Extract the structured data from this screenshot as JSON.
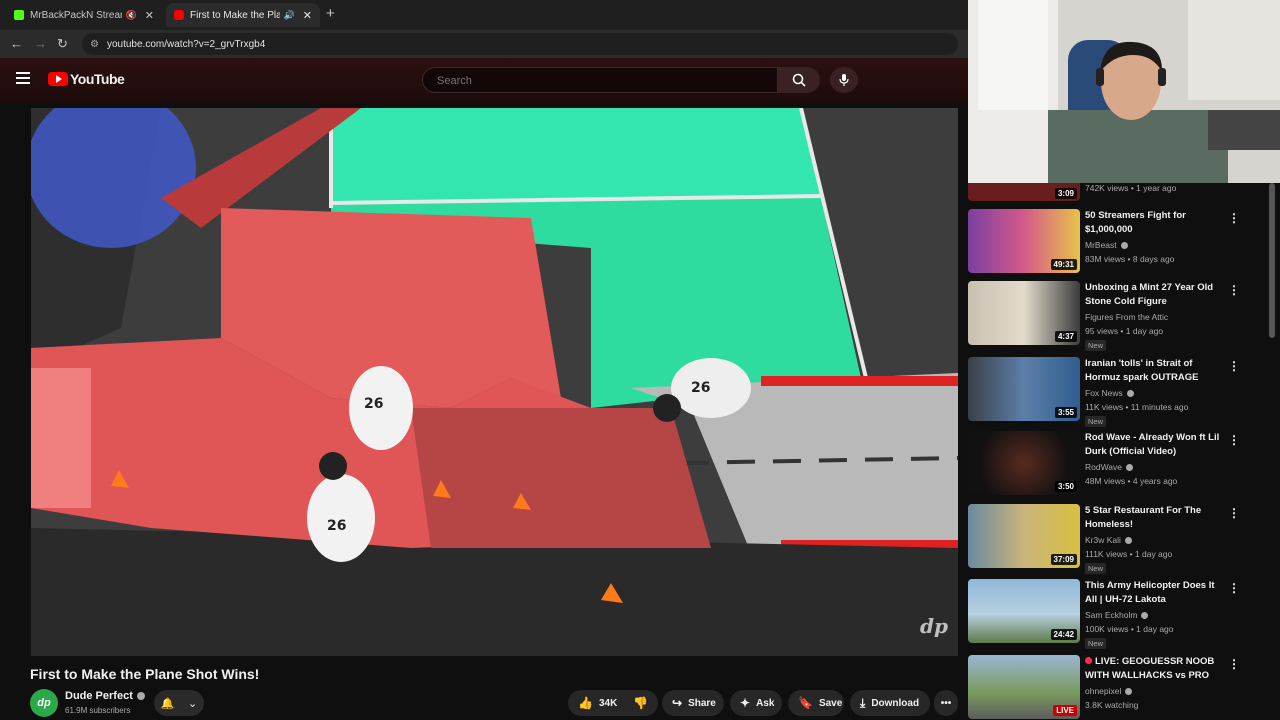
{
  "browser": {
    "tabs": [
      {
        "title": "MrBackPackN Stream - Wa",
        "icon_color": "#53fc18"
      },
      {
        "title": "First to Make the Plane Sho",
        "icon_color": "#ff0000"
      }
    ],
    "new_tab": "+",
    "url": "youtube.com/watch?v=2_grvTrxgb4"
  },
  "youtube": {
    "logo_text": "YouTube",
    "search_placeholder": "Search"
  },
  "video": {
    "title": "First to Make the Plane Shot Wins!",
    "watermark": "dp",
    "channel": {
      "name": "Dude Perfect",
      "subscribers": "61.9M subscribers",
      "avatar_text": "dp"
    },
    "actions": {
      "likes": "34K",
      "share": "Share",
      "ask": "Ask",
      "save": "Save",
      "download": "Download"
    }
  },
  "recommendations": {
    "partial_top": {
      "duration": "3:09",
      "meta": "742K views • 1 year ago"
    },
    "items": [
      {
        "title": "50 Streamers Fight for $1,000,000",
        "channel": "MrBeast",
        "verified": true,
        "meta": "83M views • 8 days ago",
        "duration": "49:31",
        "badge": ""
      },
      {
        "title": "Unboxing a Mint 27 Year Old Stone Cold Figure",
        "channel": "Figures From the Attic",
        "verified": false,
        "meta": "95 views • 1 day ago",
        "duration": "4:37",
        "badge": "New"
      },
      {
        "title": "Iranian 'tolls' in Strait of Hormuz spark OUTRAGE",
        "channel": "Fox News",
        "verified": true,
        "meta": "11K views • 11 minutes ago",
        "duration": "3:55",
        "badge": "New"
      },
      {
        "title": "Rod Wave - Already Won ft Lil Durk (Official Video)",
        "channel": "RodWave",
        "verified": true,
        "meta": "48M views • 4 years ago",
        "duration": "3:50",
        "badge": ""
      },
      {
        "title": "5 Star Restaurant For The Homeless!",
        "channel": "Kr3w Kali",
        "verified": true,
        "meta": "111K views • 1 day ago",
        "duration": "37:09",
        "badge": "New"
      },
      {
        "title": "This Army Helicopter Does It All | UH-72 Lakota",
        "channel": "Sam Eckholm",
        "verified": true,
        "meta": "100K views • 1 day ago",
        "duration": "24:42",
        "badge": "New"
      },
      {
        "title": "LIVE: GEOGUESSR NOOB WITH WALLHACKS vs PRO",
        "channel": "ohnepixel",
        "verified": true,
        "meta": "3.8K watching",
        "duration": "LIVE",
        "badge": ""
      }
    ]
  }
}
